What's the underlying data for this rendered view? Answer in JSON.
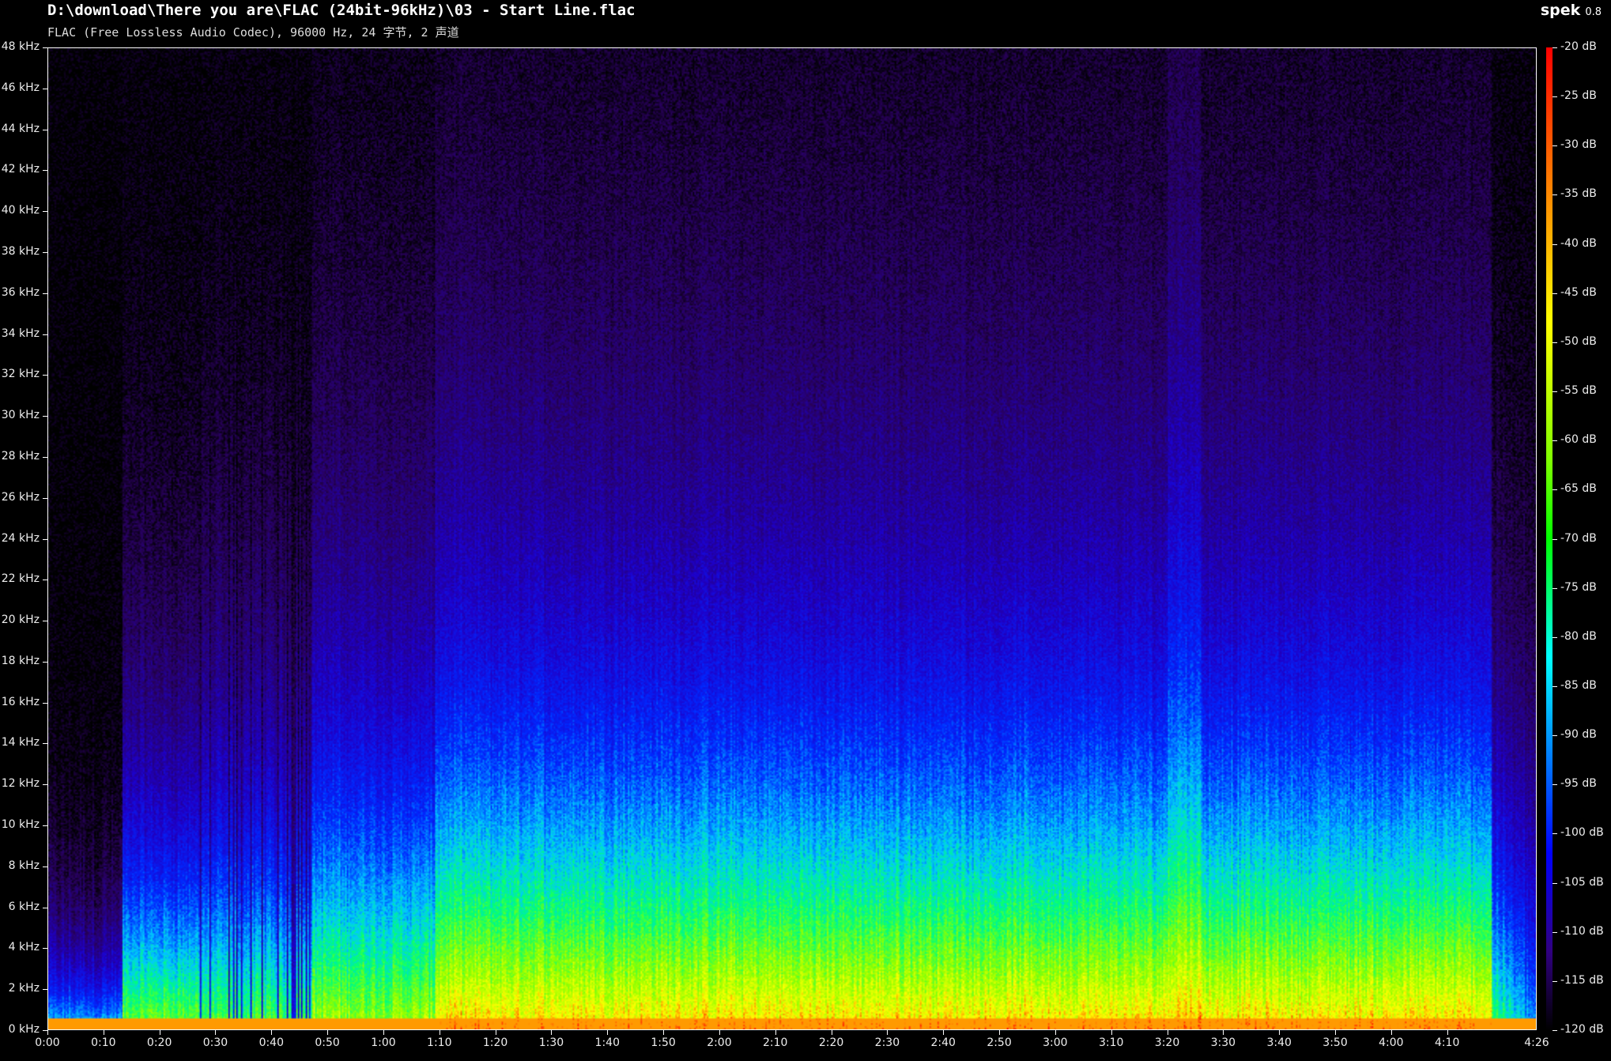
{
  "header": {
    "file_path": "D:\\download\\There you are\\FLAC (24bit-96kHz)\\03 - Start Line.flac",
    "file_info": "FLAC (Free Lossless Audio Codec), 96000 Hz, 24 字节, 2 声道",
    "app_name": "spek",
    "app_version": "0.8"
  },
  "colors": {
    "background": "#000000",
    "text": "#ffffff"
  },
  "chart_data": {
    "type": "heatmap",
    "title": "",
    "x_axis": {
      "unit": "time",
      "ticks": [
        "0:00",
        "0:10",
        "0:20",
        "0:30",
        "0:40",
        "0:50",
        "1:00",
        "1:10",
        "1:20",
        "1:30",
        "1:40",
        "1:50",
        "2:00",
        "2:10",
        "2:20",
        "2:30",
        "2:40",
        "2:50",
        "3:00",
        "3:10",
        "3:20",
        "3:30",
        "3:40",
        "3:50",
        "4:00",
        "4:10"
      ],
      "end_label": "4:26",
      "range_seconds": [
        0,
        266
      ]
    },
    "y_axis": {
      "unit": "kHz",
      "ticks": [
        "0 kHz",
        "2 kHz",
        "4 kHz",
        "6 kHz",
        "8 kHz",
        "10 kHz",
        "12 kHz",
        "14 kHz",
        "16 kHz",
        "18 kHz",
        "20 kHz",
        "22 kHz",
        "24 kHz",
        "26 kHz",
        "28 kHz",
        "30 kHz",
        "32 kHz",
        "34 kHz",
        "36 kHz",
        "38 kHz",
        "40 kHz",
        "42 kHz",
        "44 kHz",
        "46 kHz",
        "48 kHz"
      ],
      "range": [
        0,
        48
      ]
    },
    "colorbar": {
      "unit": "dB",
      "ticks": [
        "-20 dB",
        "-25 dB",
        "-30 dB",
        "-35 dB",
        "-40 dB",
        "-45 dB",
        "-50 dB",
        "-55 dB",
        "-60 dB",
        "-65 dB",
        "-70 dB",
        "-75 dB",
        "-80 dB",
        "-85 dB",
        "-90 dB",
        "-95 dB",
        "-100 dB",
        "-105 dB",
        "-110 dB",
        "-115 dB",
        "-120 dB"
      ],
      "range": [
        -120,
        -20
      ]
    }
  }
}
